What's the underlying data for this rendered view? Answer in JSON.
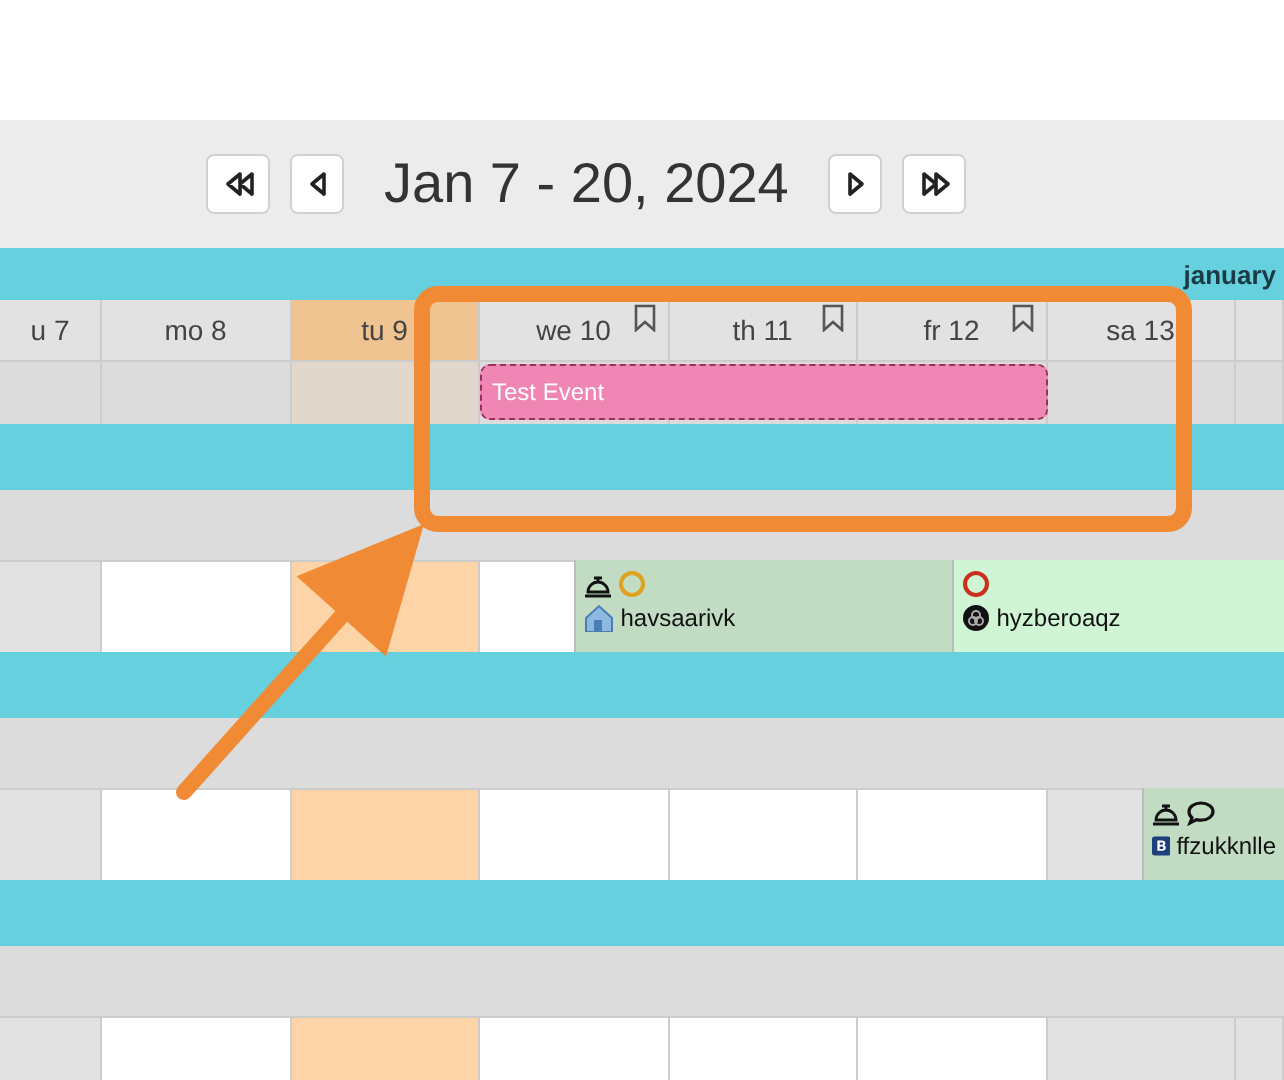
{
  "toolbar": {
    "buttons": [
      {
        "kind": "first"
      },
      {
        "kind": "prev"
      }
    ],
    "title": "Jan 7 - 20, 2024",
    "buttons_after": [
      {
        "kind": "next"
      },
      {
        "kind": "last"
      }
    ]
  },
  "month": {
    "label": "january"
  },
  "days": [
    {
      "label": "u 7",
      "weekend": true,
      "today": false,
      "marked": false
    },
    {
      "label": "mo 8",
      "weekend": false,
      "today": false,
      "marked": false
    },
    {
      "label": "tu 9",
      "weekend": false,
      "today": true,
      "marked": false
    },
    {
      "label": "we 10",
      "weekend": false,
      "today": false,
      "marked": true
    },
    {
      "label": "th 11",
      "weekend": false,
      "today": false,
      "marked": true
    },
    {
      "label": "fr 12",
      "weekend": false,
      "today": false,
      "marked": true
    },
    {
      "label": "sa 13",
      "weekend": true,
      "today": false,
      "marked": false
    },
    {
      "weekend": true,
      "today": false,
      "marked": false
    }
  ],
  "top_events": [
    {
      "title": "Test Event"
    }
  ],
  "resources": [
    {
      "kind": "row",
      "events": [
        {
          "title": "havsaarivk",
          "color": "#c2dcc4",
          "icons": [
            {
              "kind": "bell"
            },
            {
              "kind": "ring",
              "color": "#e0a020"
            }
          ],
          "logo": {
            "kind": "house"
          }
        },
        {
          "title": "hyzberoaqz",
          "color": "#d0f5d4",
          "icons": [
            {
              "kind": "ring",
              "color": "#c83020"
            }
          ],
          "logo": {
            "kind": "dark"
          }
        }
      ]
    },
    {
      "kind": "row",
      "events": [
        {
          "title": "ffzukknlle",
          "color": "#c2dcc4",
          "icons": [
            {
              "kind": "bell"
            },
            {
              "kind": "bubble"
            }
          ],
          "logo": {
            "kind": "b"
          }
        }
      ]
    },
    {
      "kind": "row"
    }
  ],
  "annotations": [
    {
      "kind": "frame"
    },
    {
      "kind": "arrow"
    }
  ]
}
